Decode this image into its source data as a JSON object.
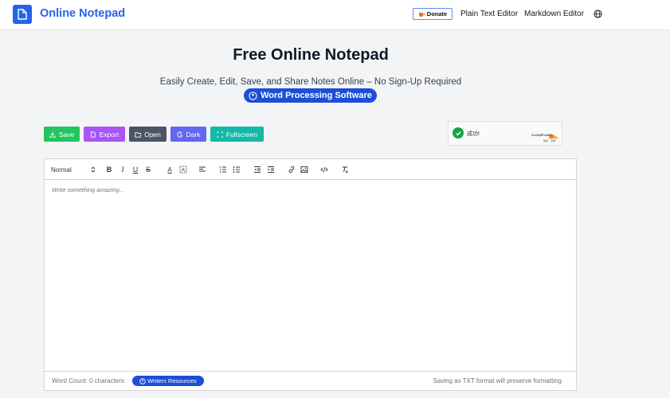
{
  "header": {
    "brand": "Online Notepad",
    "donate_label": "Donate",
    "nav": [
      "Plain Text Editor",
      "Markdown Editor"
    ],
    "icons": {
      "brand": "document-icon",
      "language": "globe-icon",
      "donate": "coffee-icon"
    }
  },
  "hero": {
    "title": "Free Online Notepad",
    "subtitle": "Easily Create, Edit, Save, and Share Notes Online – No Sign-Up Required",
    "pill": "Word Processing Software"
  },
  "actions": {
    "save": "Save",
    "export": "Export",
    "open": "Open",
    "dark": "Dark",
    "fullscreen": "Fullscreen"
  },
  "captcha": {
    "status": "成功!",
    "brand": "CLOUDFLARE",
    "links": "隐私 · 条款"
  },
  "toolbar": {
    "header_select": "Normal"
  },
  "editor": {
    "placeholder": "Write something amazing..."
  },
  "footer": {
    "word_count": "Word Count: 0 characters",
    "resources": "Writers Resources",
    "format_note": "Saving as TXT format will preserve formatting"
  },
  "colors": {
    "brand": "#2563eb",
    "save": "#22c55e",
    "export": "#a855f7",
    "open": "#4b5563",
    "dark": "#6366f1",
    "fullscreen": "#14b8a6",
    "pill": "#1d4ed8",
    "cloudflare": "#f38020"
  }
}
